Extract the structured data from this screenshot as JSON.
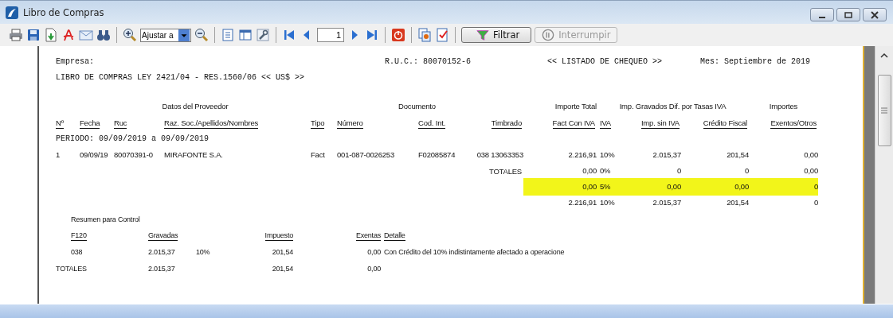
{
  "window": {
    "title": "Libro de Compras"
  },
  "toolbar": {
    "zoom": {
      "value": "Ajustar a"
    },
    "page": {
      "value": "1"
    },
    "buttons": [
      {
        "label": "Filtrar",
        "disabled": false
      },
      {
        "label": "Interrumpir",
        "disabled": true
      }
    ]
  },
  "report": {
    "empresa": "Empresa:",
    "ruc": "R.U.C.: 80070152-6",
    "listado": "<< LISTADO DE CHEQUEO >>",
    "mes": "Mes: Septiembre de 2019",
    "title": "LIBRO DE COMPRAS LEY 2421/04 - RES.1560/06 << US$ >>",
    "groups": [
      "Datos del Proveedor",
      "Documento",
      "Importe Total",
      "Imp. Gravados Dif. por Tasas IVA",
      "Importes"
    ],
    "columns": [
      "Nº",
      "Fecha",
      "Ruc",
      "Raz. Soc./Apellidos/Nombres",
      "Tipo",
      "Número",
      "Cod. Int.",
      "Timbrado",
      "Fact Con IVA",
      "IVA",
      "Imp. sin IVA",
      "Crédito Fiscal",
      "Exentos/Otros"
    ],
    "periodo": "PERIODO: 09/09/2019 a 09/09/2019",
    "rows": [
      {
        "kind": "item",
        "highlighted": false,
        "cells": [
          "1",
          "09/09/19",
          "80070391-0",
          "MIRAFONTE S.A.",
          "Fact",
          "001-087-0026253",
          "F02085874",
          "038 13063353",
          "2.216,91",
          "10%",
          "2.015,37",
          "201,54",
          "0,00"
        ]
      },
      {
        "kind": "total",
        "highlighted": false,
        "label": "TOTALES",
        "cells": [
          "0,00",
          "0%",
          "0",
          "0",
          "0,00"
        ]
      },
      {
        "kind": "total",
        "highlighted": true,
        "cells": [
          "0,00",
          "5%",
          "0,00",
          "0,00",
          "0"
        ]
      },
      {
        "kind": "total",
        "highlighted": false,
        "cells": [
          "2.216,91",
          "10%",
          "2.015,37",
          "201,54",
          "0"
        ]
      }
    ],
    "summary": {
      "title": "Resumen para Control",
      "columns": [
        "F120",
        "Gravadas",
        "",
        "Impuesto",
        "Exentas",
        "Detalle"
      ],
      "rows": [
        {
          "kind": "item",
          "cells": [
            "038",
            "2.015,37",
            "10%",
            "201,54",
            "0,00",
            "Con Crédito del 10% indistintamente afectado a operacione"
          ]
        },
        {
          "kind": "total",
          "cells": [
            "TOTALES",
            "2.015,37",
            "",
            "201,54",
            "0,00",
            ""
          ]
        }
      ]
    }
  }
}
